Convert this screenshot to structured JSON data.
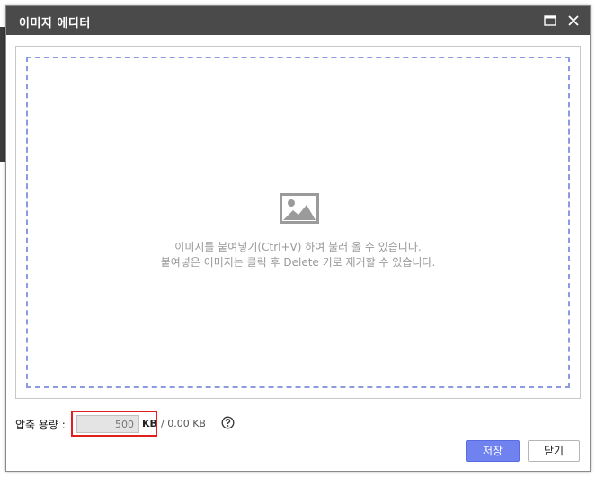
{
  "dialog": {
    "title": "이미지 에디터",
    "maximize_icon": "maximize-icon",
    "close_icon": "close-icon"
  },
  "editor": {
    "placeholder_icon": "image-icon",
    "hint_line1": "이미지를 붙여넣기(Ctrl+V) 하여 불러 올 수 있습니다.",
    "hint_line2": "붙여넣은 이미지는 클릭 후 Delete 키로 제거할 수 있습니다."
  },
  "compression": {
    "label": "압축 용량 :",
    "placeholder": "500",
    "unit": "KB",
    "current_size": "/ 0.00 KB",
    "help_icon": "question-circle-icon"
  },
  "buttons": {
    "save_label": "저장",
    "close_label": "닫기"
  },
  "colors": {
    "titlebar": "#4a4a4a",
    "dropzone_border": "#8c9ae0",
    "save_button": "#6f82f0",
    "highlight": "#e0201c"
  }
}
